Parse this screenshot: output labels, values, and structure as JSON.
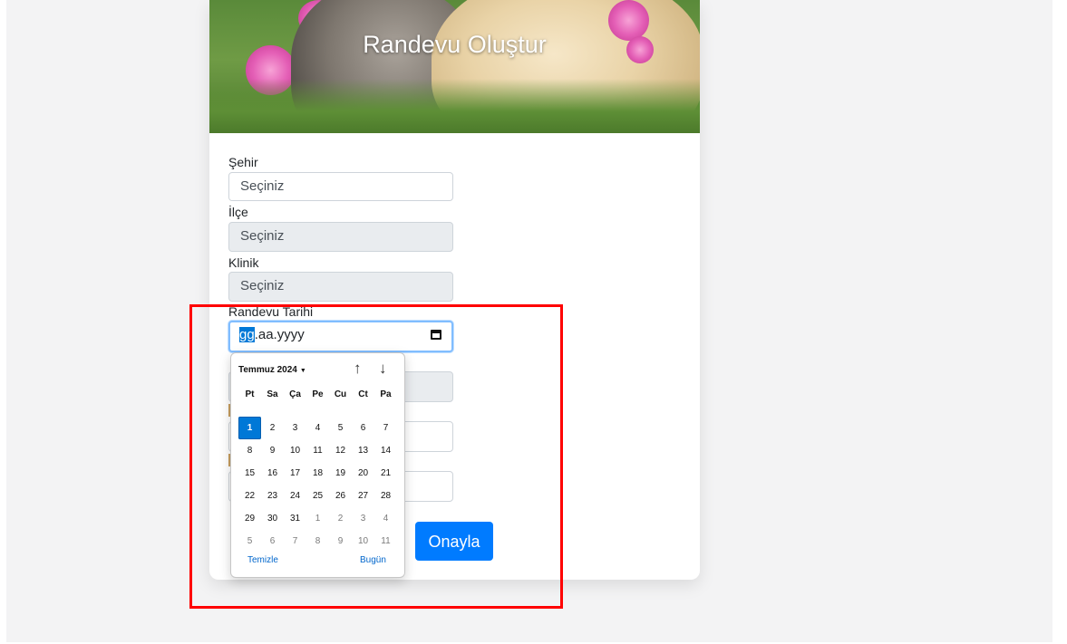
{
  "hero": {
    "title": "Randevu Oluştur"
  },
  "form": {
    "city": {
      "label": "Şehir",
      "value": "Seçiniz"
    },
    "district": {
      "label": "İlçe",
      "value": "Seçiniz"
    },
    "clinic": {
      "label": "Klinik",
      "value": "Seçiniz"
    },
    "date": {
      "label": "Randevu Tarihi",
      "seg_day": "gg",
      "seg_rest": ".aa.yyyy"
    },
    "confirm_label": "Onayla"
  },
  "calendar": {
    "month_label": "Temmuz 2024",
    "caret": "▼",
    "prev_arrow": "↑",
    "next_arrow": "↓",
    "weekdays": [
      "Pt",
      "Sa",
      "Ça",
      "Pe",
      "Cu",
      "Ct",
      "Pa"
    ],
    "days": [
      {
        "d": "1",
        "other": false,
        "selected": true
      },
      {
        "d": "2",
        "other": false
      },
      {
        "d": "3",
        "other": false
      },
      {
        "d": "4",
        "other": false
      },
      {
        "d": "5",
        "other": false
      },
      {
        "d": "6",
        "other": false
      },
      {
        "d": "7",
        "other": false
      },
      {
        "d": "8",
        "other": false
      },
      {
        "d": "9",
        "other": false
      },
      {
        "d": "10",
        "other": false
      },
      {
        "d": "11",
        "other": false
      },
      {
        "d": "12",
        "other": false
      },
      {
        "d": "13",
        "other": false
      },
      {
        "d": "14",
        "other": false
      },
      {
        "d": "15",
        "other": false
      },
      {
        "d": "16",
        "other": false
      },
      {
        "d": "17",
        "other": false
      },
      {
        "d": "18",
        "other": false
      },
      {
        "d": "19",
        "other": false
      },
      {
        "d": "20",
        "other": false
      },
      {
        "d": "21",
        "other": false
      },
      {
        "d": "22",
        "other": false
      },
      {
        "d": "23",
        "other": false
      },
      {
        "d": "24",
        "other": false
      },
      {
        "d": "25",
        "other": false
      },
      {
        "d": "26",
        "other": false
      },
      {
        "d": "27",
        "other": false
      },
      {
        "d": "28",
        "other": false
      },
      {
        "d": "29",
        "other": false
      },
      {
        "d": "30",
        "other": false
      },
      {
        "d": "31",
        "other": false
      },
      {
        "d": "1",
        "other": true
      },
      {
        "d": "2",
        "other": true
      },
      {
        "d": "3",
        "other": true
      },
      {
        "d": "4",
        "other": true
      },
      {
        "d": "5",
        "other": true
      },
      {
        "d": "6",
        "other": true
      },
      {
        "d": "7",
        "other": true
      },
      {
        "d": "8",
        "other": true
      },
      {
        "d": "9",
        "other": true
      },
      {
        "d": "10",
        "other": true
      },
      {
        "d": "11",
        "other": true
      }
    ],
    "clear_label": "Temizle",
    "today_label": "Bugün"
  }
}
